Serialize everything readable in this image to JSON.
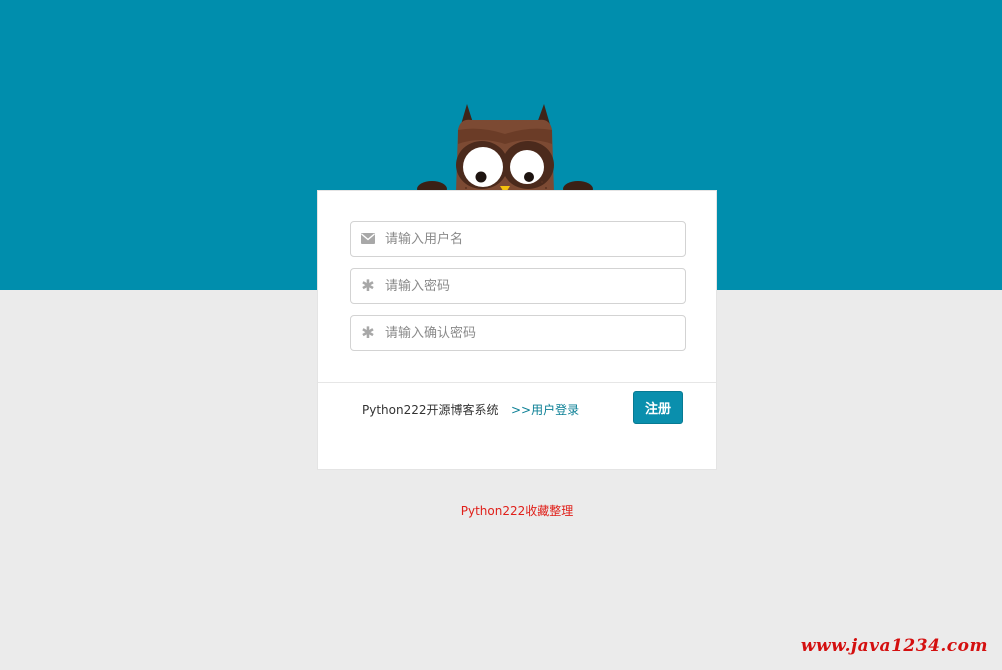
{
  "colors": {
    "top_band": "#008ead",
    "background": "#ebebeb",
    "card": "#ffffff",
    "button": "#0a8fad",
    "link": "#0a7f95",
    "credit": "#e0201a",
    "watermark": "#d40f0f"
  },
  "form": {
    "username": {
      "icon": "envelope-icon",
      "placeholder": "请输入用户名",
      "value": ""
    },
    "password": {
      "icon": "asterisk-icon",
      "placeholder": "请输入密码",
      "value": ""
    },
    "confirm_password": {
      "icon": "asterisk-icon",
      "placeholder": "请输入确认密码",
      "value": ""
    }
  },
  "footer": {
    "system_name": "Python222开源博客系统",
    "login_link": ">>用户登录",
    "register_button": "注册"
  },
  "credit_text": "Python222收藏整理",
  "watermark_text": "www.java1234.com"
}
